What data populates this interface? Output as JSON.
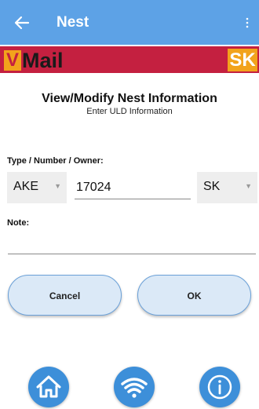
{
  "appbar": {
    "title": "Nest",
    "back_icon": "arrow-left-icon",
    "menu_icon": "overflow-dots-icon"
  },
  "banner": {
    "brand_letter": "V",
    "brand_word": "Mail",
    "carrier_code": "SK"
  },
  "header": {
    "title": "View/Modify Nest Information",
    "subtitle": "Enter ULD Information"
  },
  "form": {
    "type_label": "Type / Number / Owner:",
    "type_value": "AKE",
    "number_value": "17024",
    "owner_value": "SK",
    "note_label": "Note:",
    "note_value": ""
  },
  "buttons": {
    "cancel": "Cancel",
    "ok": "OK"
  },
  "bottom_nav": {
    "home_icon": "home-icon",
    "wifi_icon": "wifi-icon",
    "info_icon": "info-icon"
  },
  "colors": {
    "appbar": "#5da2e6",
    "banner": "#c42040",
    "brand_accent": "#f2a31c",
    "nav_button": "#3d8fd9"
  }
}
